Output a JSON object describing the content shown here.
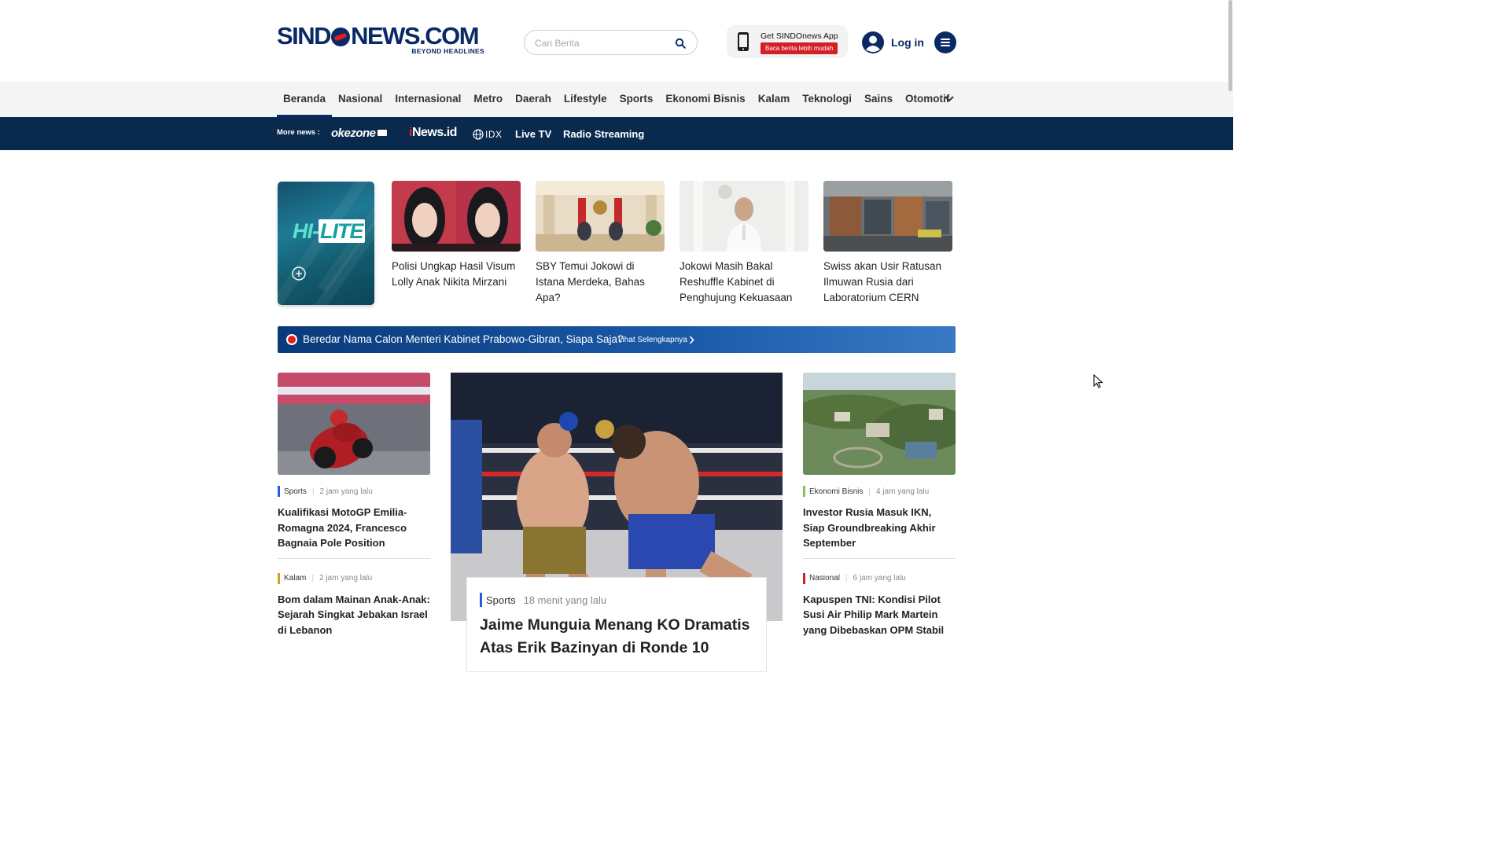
{
  "header": {
    "logo_text": "SINDONEWS.COM",
    "logo_tagline": "BEYOND HEADLINES",
    "search_placeholder": "Cari Berita",
    "app_promo_title": "Get SINDOnews App",
    "app_promo_badge": "Baca berita lebih mudah",
    "login_label": "Log in"
  },
  "category_nav": {
    "items": [
      "Beranda",
      "Nasional",
      "Internasional",
      "Metro",
      "Daerah",
      "Lifestyle",
      "Sports",
      "Ekonomi Bisnis",
      "Kalam",
      "Teknologi",
      "Sains",
      "Otomotif"
    ],
    "active": "Beranda"
  },
  "more_news": {
    "label": "More news :",
    "okezone": "okezone",
    "inews": "News.id",
    "inews_prefix": "i",
    "idx": "IDX",
    "live_tv": "Live TV",
    "radio": "Radio Streaming"
  },
  "hilite": {
    "logo_hi": "HI-",
    "logo_lite": "LITE",
    "items": [
      {
        "title": "Polisi Ungkap Hasil Visum Lolly Anak Nikita Mirzani"
      },
      {
        "title": "SBY Temui Jokowi di Istana Merdeka, Bahas Apa?"
      },
      {
        "title": "Jokowi Masih Bakal Reshuffle Kabinet di Penghujung Kekuasaan"
      },
      {
        "title": "Swiss akan Usir Ratusan Ilmuwan Rusia dari Laboratorium CERN"
      }
    ]
  },
  "breaking": {
    "headline": "Beredar Nama Calon Menteri Kabinet Prabowo-Gibran, Siapa Saja?",
    "more_label": "Lihat Selengkapnya"
  },
  "left_column": [
    {
      "category": "Sports",
      "category_color": "#2a5bd7",
      "time": "2 jam yang lalu",
      "title": "Kualifikasi MotoGP Emilia-Romagna 2024, Francesco Bagnaia Pole Position"
    },
    {
      "category": "Kalam",
      "category_color": "#d4a017",
      "time": "2 jam yang lalu",
      "title": "Bom dalam Mainan Anak-Anak: Sejarah Singkat Jebakan Israel di Lebanon"
    }
  ],
  "main_article": {
    "category": "Sports",
    "category_color": "#2a5bd7",
    "time": "18 menit yang lalu",
    "title": "Jaime Munguia Menang KO Dramatis Atas Erik Bazinyan di Ronde 10"
  },
  "right_column": [
    {
      "category": "Ekonomi Bisnis",
      "category_color": "#8bc34a",
      "time": "4 jam yang lalu",
      "title": "Investor Rusia Masuk IKN, Siap Groundbreaking Akhir September"
    },
    {
      "category": "Nasional",
      "category_color": "#d32027",
      "time": "6 jam yang lalu",
      "title": "Kapuspen TNI: Kondisi Pilot Susi Air Philip Mark Martein yang Dibebaskan OPM Stabil"
    }
  ]
}
